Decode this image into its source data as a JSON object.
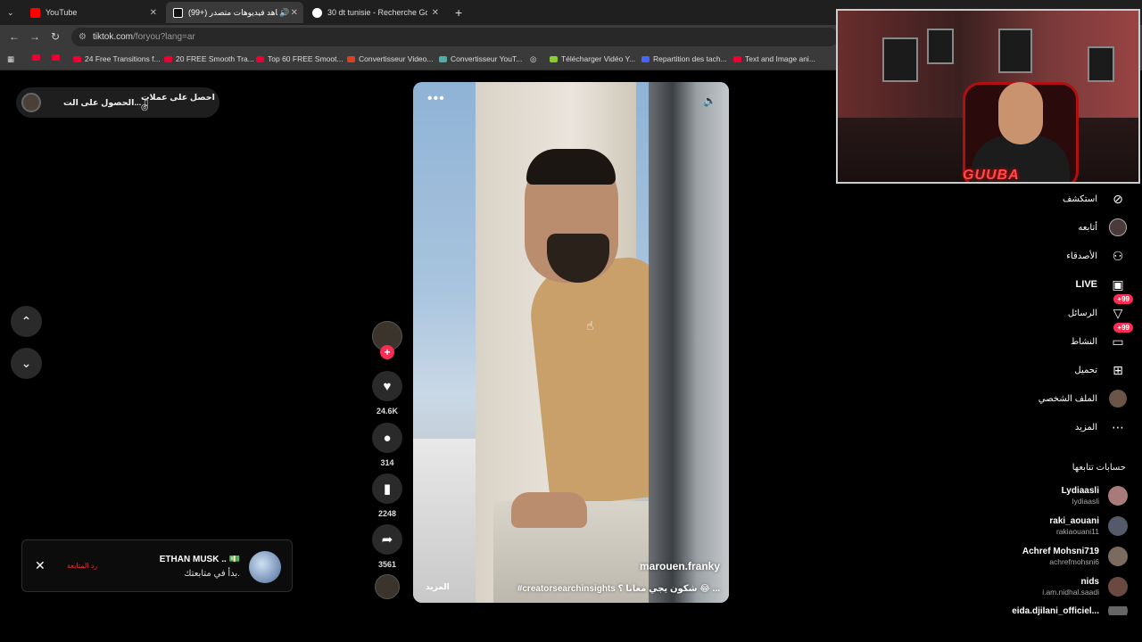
{
  "browser": {
    "tabs": [
      {
        "title": "YouTube",
        "favicon": "youtube-icon"
      },
      {
        "title": "(99+) شاهد فيديوهات متصدر",
        "favicon": "tiktok-icon",
        "active": true
      },
      {
        "title": "30 dt tunisie - Recherche Goog",
        "favicon": "google-icon"
      }
    ],
    "new_tab": "+",
    "url_domain": "tiktok.com",
    "url_path": "/foryou?lang=ar",
    "bookmarks": [
      "24 Free Transitions f...",
      "20 FREE Smooth Tra...",
      "Top 60 FREE Smoot...",
      "Convertisseur Video...",
      "Convertisseur YouT...",
      "Télécharger Vidéo Y...",
      "Repartition des tach...",
      "Text and Image ani..."
    ]
  },
  "top_pill": {
    "coins": "احصل على عملات",
    "get_app": "الحصول على الت..."
  },
  "video": {
    "author": "marouen.franky",
    "caption": "#creatorsearchinsights شكون يجي معانا ؟ 😂 ...",
    "more": "المزيد",
    "menu_icon": "•••"
  },
  "actions": {
    "likes": "24.6K",
    "comments": "314",
    "saves": "2248",
    "shares": "3561"
  },
  "notification": {
    "name": "ETHAN MUSK .. 💵",
    "message": "بدأ في متابعتك.",
    "follow_back": "رد المتابعة"
  },
  "webcam": {
    "logo": "GUUBA"
  },
  "right_nav": [
    {
      "label": "استكشف",
      "icon": "compass-icon"
    },
    {
      "label": "أتابعه",
      "icon": "following-avatar-icon"
    },
    {
      "label": "الأصدقاء",
      "icon": "friends-icon"
    },
    {
      "label": "LIVE",
      "icon": "live-tv-icon"
    },
    {
      "label": "الرسائل",
      "icon": "messages-icon",
      "badge": "+99"
    },
    {
      "label": "النشاط",
      "icon": "activity-icon",
      "badge": "+99"
    },
    {
      "label": "تحميل",
      "icon": "upload-icon"
    },
    {
      "label": "الملف الشخصي",
      "icon": "profile-icon"
    },
    {
      "label": "المزيد",
      "icon": "more-icon"
    }
  ],
  "following_accounts": {
    "title": "حسابات تتابعها",
    "items": [
      {
        "name": "Lydiaasli",
        "handle": "lydiaasli"
      },
      {
        "name": "raki_aouani",
        "handle": "rakiaouani11"
      },
      {
        "name": "Achref Mohsni719",
        "handle": "achrefmohsni6"
      },
      {
        "name": "nids",
        "handle": "i.am.nidhal.saadi"
      },
      {
        "name": "eida.djilani_officiel...",
        "handle": ""
      }
    ]
  },
  "colors": {
    "accent": "#fe2c55",
    "background": "#000000"
  }
}
